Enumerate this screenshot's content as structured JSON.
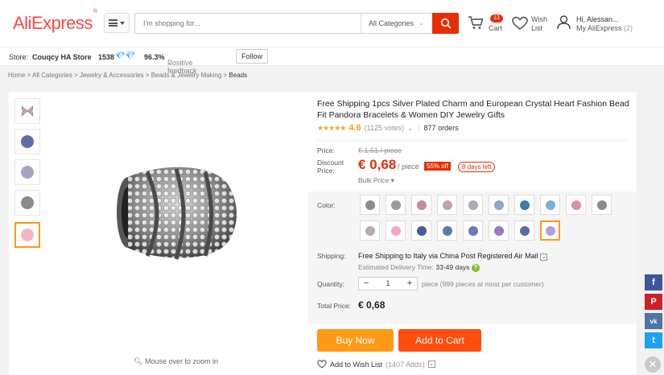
{
  "header": {
    "logo": "AliExpress",
    "search_placeholder": "I'm shopping for...",
    "category": "All Categories",
    "cart_count": "13",
    "cart_label": "Cart",
    "wish_label_1": "Wish",
    "wish_label_2": "List",
    "account_greeting": "Hi, Alessan...",
    "account_link": "My AliExpress",
    "account_count": "(2)"
  },
  "store": {
    "label": "Store:",
    "name": "Couqcy HA Store",
    "score": "1538",
    "feedback_percent": "96.3%",
    "feedback_label": "Positive feedback",
    "follow_label": "Follow"
  },
  "breadcrumb": [
    {
      "label": "Home",
      "current": false
    },
    {
      "label": "All Categories",
      "current": false
    },
    {
      "label": "Jewelry & Accessories",
      "current": false
    },
    {
      "label": "Beads & Jewelry Making",
      "current": false
    },
    {
      "label": "Beads",
      "current": true
    }
  ],
  "gallery": {
    "thumb_colors": [
      "#c9a3ad",
      "#5f6fa8",
      "#a9a4c6",
      "#8c8c8c",
      "#f3b6c6"
    ],
    "active_index": 4,
    "zoom_hint": "Mouse over to zoom in"
  },
  "product": {
    "title": "Free Shipping 1pcs Silver Plated Charm and European Crystal Heart Fashion Bead Fit Pandora Bracelets & Women DIY Jewelry Gifts",
    "rating": "4.6",
    "votes": "(1125 votes)",
    "orders": "877 orders",
    "price_label": "Price:",
    "old_price": "€ 1,51 / piece",
    "discount_label_1": "Discount",
    "discount_label_2": "Price:",
    "price": "€ 0,68",
    "unit": "/ piece",
    "off": "55% off",
    "days_left": "8 days left",
    "bulk_price": "Bulk Price",
    "color_label": "Color:",
    "swatch_colors": [
      "#8a8a8a",
      "#9a9a9a",
      "#c98a9a",
      "#c4a0b4",
      "#b0a8b8",
      "#8aa8c8",
      "#3c7aa8",
      "#7ab0d8",
      "#e08aa8",
      "#8a8a8a",
      "#b8a8b0",
      "#f0a8c0",
      "#4a5a9a",
      "#5a7ab0",
      "#6a78b8",
      "#9a7ac0",
      "#5a6aa8",
      "#b0a0d8"
    ],
    "active_swatch": 17,
    "shipping_label": "Shipping:",
    "shipping_text": "Free Shipping to Italy via China Post Registered Air Mail",
    "delivery_label": "Estimated Delivery Time:",
    "delivery_value": "33-49 days",
    "quantity_label": "Quantity:",
    "quantity_value": "1",
    "quantity_note": "piece (999 pieces at most per customer)",
    "total_label": "Total Price:",
    "total_value": "€ 0,68",
    "buy_now": "Buy Now",
    "add_to_cart": "Add to Cart",
    "wish_label": "Add to Wish List",
    "wish_count": "(1407 Adds)"
  },
  "social": [
    "f",
    "P",
    "vk",
    "t"
  ],
  "colors": {
    "accent": "#ff4747",
    "orange": "#ff9a17",
    "red": "#e62e04",
    "facebook": "#3b5998",
    "pinterest": "#cb2027",
    "vk": "#4c75a3",
    "twitter": "#1da1f2"
  }
}
